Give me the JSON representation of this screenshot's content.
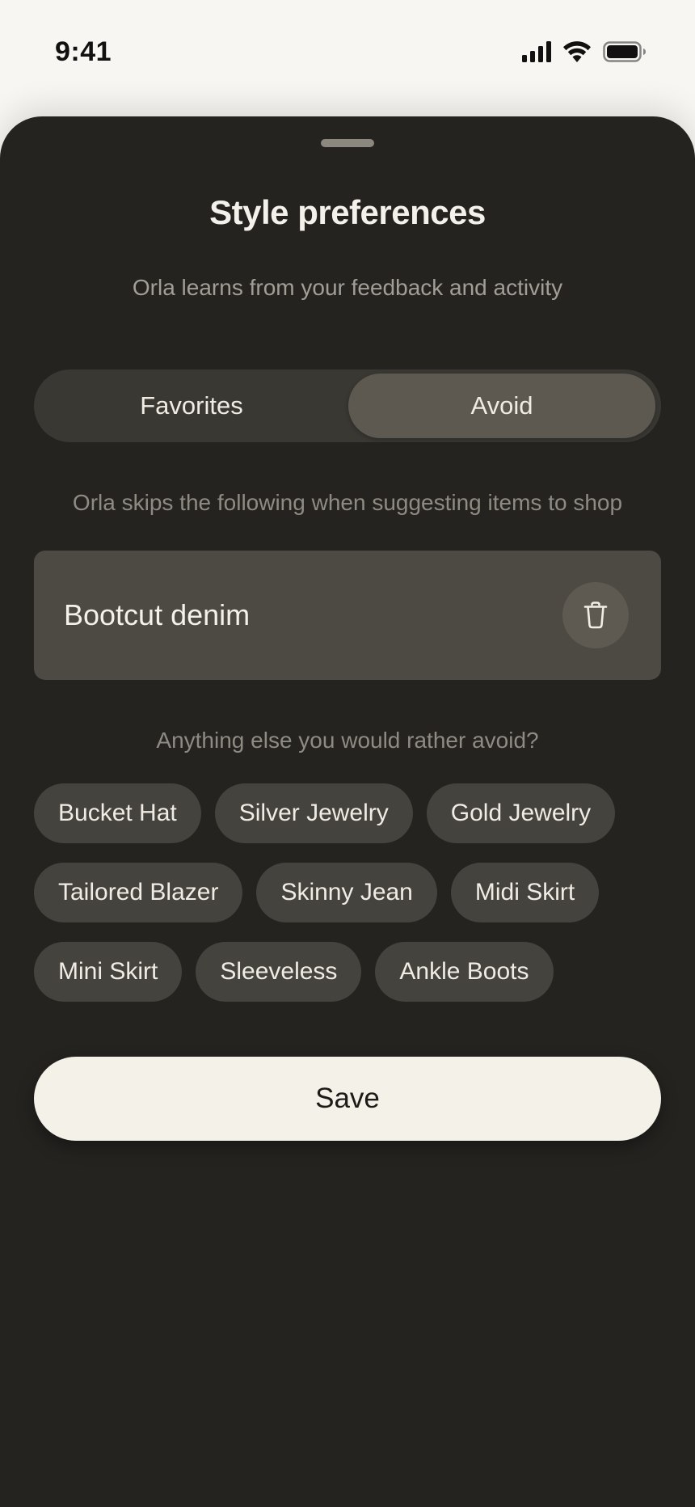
{
  "status_bar": {
    "time": "9:41"
  },
  "sheet": {
    "title": "Style preferences",
    "subtitle": "Orla learns from your feedback and activity"
  },
  "tabs": [
    {
      "label": "Favorites",
      "selected": false
    },
    {
      "label": "Avoid",
      "selected": true
    }
  ],
  "avoid": {
    "info_text": "Orla skips the following when suggesting items to shop",
    "items": [
      {
        "label": "Bootcut denim"
      }
    ],
    "prompt": "Anything else you would rather avoid?",
    "suggestions": [
      "Bucket Hat",
      "Silver Jewelry",
      "Gold Jewelry",
      "Tailored Blazer",
      "Skinny Jean",
      "Midi Skirt",
      "Mini Skirt",
      "Sleeveless",
      "Ankle Boots"
    ]
  },
  "save_label": "Save",
  "icons": {
    "signal": "cellular-signal-icon",
    "wifi": "wifi-icon",
    "battery": "battery-icon",
    "delete": "trash-icon"
  },
  "colors": {
    "sheet_bg": "#242320",
    "accent_selected": "#5d5950",
    "save_bg": "#f3f1e8"
  }
}
